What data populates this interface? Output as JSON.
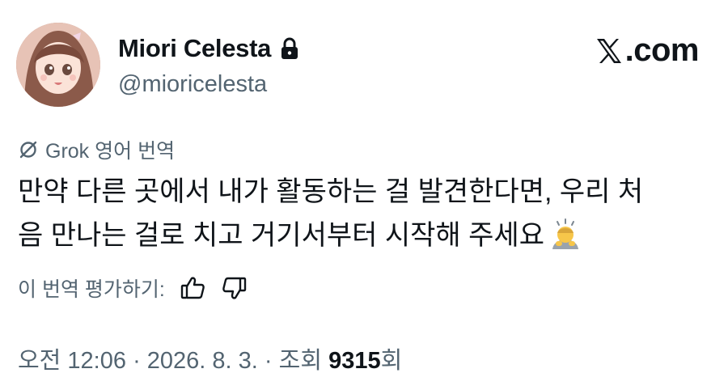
{
  "author": {
    "display_name": "Miori Celesta",
    "handle": "@mioricelesta",
    "protected_icon": "lock-icon"
  },
  "brand": {
    "text": ".com",
    "icon": "x-logo-icon"
  },
  "translation": {
    "icon": "grok-icon",
    "label": "Grok 영어 번역"
  },
  "tweet": {
    "lines": [
      "만약 다른 곳에서 내가 활동하는 걸 발견한다면, 우리 처",
      "음 만나는 걸로 치고 거기서부터 시작해 주세요"
    ],
    "emoji": "bowing-person-emoji"
  },
  "rating": {
    "label": "이 번역 평가하기:",
    "thumbs_up_icon": "thumbs-up-icon",
    "thumbs_down_icon": "thumbs-down-icon"
  },
  "meta": {
    "time": "오전 12:06",
    "date": "2026. 8. 3.",
    "views_prefix": "조회",
    "views_count": "9315",
    "views_suffix": "회",
    "separator": "·"
  },
  "colors": {
    "text_primary": "#0f1419",
    "text_secondary": "#536471",
    "background": "#ffffff"
  }
}
